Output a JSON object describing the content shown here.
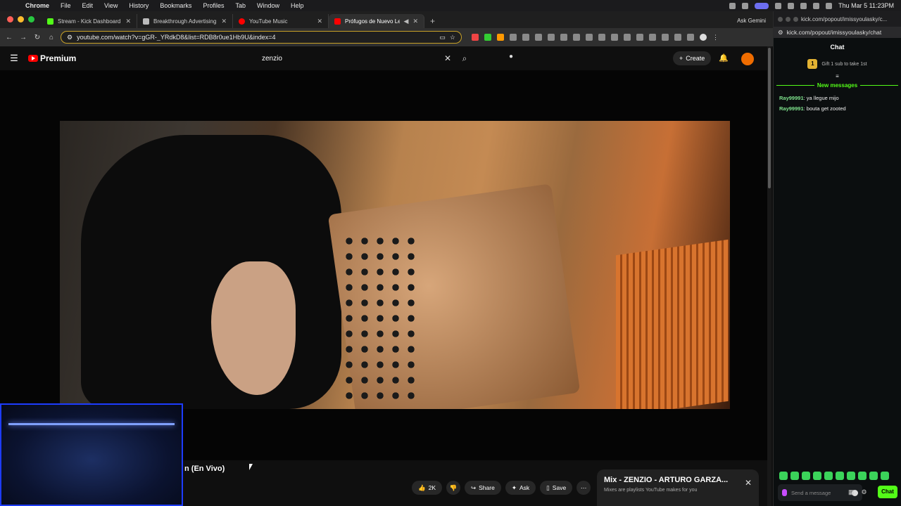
{
  "menubar": {
    "app": "Chrome",
    "items": [
      "File",
      "Edit",
      "View",
      "History",
      "Bookmarks",
      "Profiles",
      "Tab",
      "Window",
      "Help"
    ],
    "clock": "Thu Mar 5  11:23PM"
  },
  "tabs": [
    {
      "title": "Stream - Kick Dashboard",
      "fav_color": "#53fc18"
    },
    {
      "title": "Breakthrough Advertising - ",
      "fav_color": "#bbbbbb"
    },
    {
      "title": "YouTube Music",
      "fav_color": "#ff0000"
    },
    {
      "title": "Prófugos de Nuevo León",
      "fav_color": "#ff0000"
    }
  ],
  "ask_gemini": "Ask Gemini",
  "address": {
    "url": "youtube.com/watch?v=gGR-_YRdkD8&list=RDB8r0ue1Hb9U&index=4"
  },
  "youtube": {
    "logo_text": "Premium",
    "search_value": "zenzio",
    "create_label": "Create"
  },
  "video": {
    "title_visible": "n (En Vivo)",
    "likes": "2K",
    "share_label": "Share",
    "ask_label": "Ask",
    "save_label": "Save"
  },
  "mix": {
    "title": "Mix - ZENZIO - ARTURO GARZA...",
    "subtitle": "Mixes are playlists YouTube makes for you"
  },
  "kick": {
    "window_url": "kick.com/popout/imissyoulasky/c...",
    "url": "kick.com/popout/imissyoulasky/chat",
    "header": "Chat",
    "gift_badge": "1",
    "gift_text": "Gift 1 sub to take 1st",
    "new_messages": "New messages",
    "messages": [
      {
        "user": "Ray99991",
        "text": ": ya llegue mijo"
      },
      {
        "user": "Ray99991",
        "text": ": bouta get zooted"
      }
    ],
    "input_placeholder": "Send a message",
    "chat_button": "Chat"
  }
}
